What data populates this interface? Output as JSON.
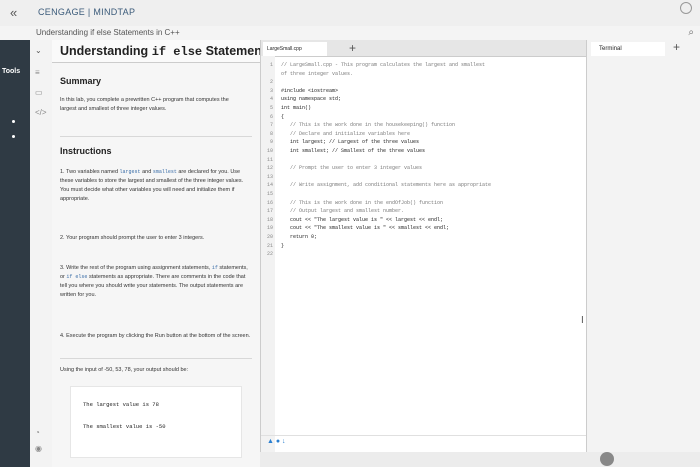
{
  "browser": {
    "brand": "CENGAGE | MINDTAP",
    "breadcrumb": "Understanding if else Statements in C++"
  },
  "tools_label": "Tools",
  "instructions_panel": {
    "title_prefix": "Understanding",
    "title_code": "if else",
    "title_suffix": "Statements",
    "summary_heading": "Summary",
    "summary_text": "In this lab, you complete a prewritten C++ program that computes the largest and smallest of three integer values.",
    "instructions_heading": "Instructions",
    "steps": [
      {
        "num": "1.",
        "pre": "Two variables named",
        "code1": "largest",
        "mid": "and",
        "code2": "smallest",
        "post": "are declared for you. Use these variables to store the largest and smallest of the three integer values. You must decide what other variables you will need and initialize them if appropriate."
      },
      {
        "num": "2.",
        "text": "Your program should prompt the user to enter 3 integers."
      },
      {
        "num": "3.",
        "pre": "Write the rest of the program using assignment statements,",
        "code1": "if",
        "mid": "statements, or",
        "code2": "if else",
        "post": "statements as appropriate. There are comments in the code that tell you where you should write your statements. The output statements are written for you."
      },
      {
        "num": "4.",
        "text": "Execute the program by clicking the Run button at the bottom of the screen."
      }
    ],
    "example_intro": "Using the input of -50, 53, 78, your output should be:",
    "example_output": [
      "The largest value is 78",
      "The smallest value is -50"
    ]
  },
  "editor": {
    "tab_label": "LargeSmall.cpp",
    "lines": [
      "// LargeSmall.cpp - This program calculates the largest and smallest",
      "of three integer values.",
      "",
      "#include <iostream>",
      "using namespace std;",
      "int main()",
      "{",
      "   // This is the work done in the housekeeping() function",
      "   // Declare and initialize variables here",
      "   int largest; // Largest of the three values",
      "   int smallest; // Smallest of the three values",
      "",
      "   // Prompt the user to enter 3 integer values",
      "",
      "   // Write assignment, add conditional statements here as appropriate",
      "",
      "   // This is the work done in the endOfJob() function",
      "   // Output largest and smallest number.",
      "   cout << \"The largest value is \" << largest << endl;",
      "   cout << \"The smallest value is \" << smallest << endl;",
      "   return 0;",
      "}",
      ""
    ],
    "line_numbers": [
      "1",
      "",
      "2",
      "3",
      "4",
      "5",
      "6",
      "7",
      "8",
      "9",
      "10",
      "11",
      "12",
      "13",
      "14",
      "15",
      "16",
      "17",
      "18",
      "19",
      "20",
      "21",
      "22"
    ]
  },
  "terminal": {
    "tab_label": "Terminal"
  }
}
